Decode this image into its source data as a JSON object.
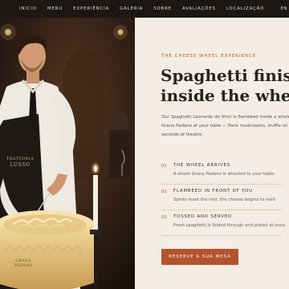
{
  "nav": {
    "items": [
      {
        "label": "INÍCIO"
      },
      {
        "label": "MENU"
      },
      {
        "label": "EXPERIÊNCIA"
      },
      {
        "label": "GALERIA"
      },
      {
        "label": "SOBRE"
      },
      {
        "label": "AVALIAÇÕES"
      },
      {
        "label": "LOCALIZAÇÃO"
      }
    ],
    "lang": "EN"
  },
  "photo": {
    "apron_line1": "TRATTORIA",
    "apron_line2": "LUSSO",
    "wheel_line1": "GRANA",
    "wheel_line2": "PADANO"
  },
  "hero": {
    "eyebrow": "THE CHEESE WHEEL EXPERIENCE",
    "headline_line1": "Spaghetti finished",
    "headline_line2": "inside the wheel.",
    "description_line1": "Our Spaghetti Leonardo de Vinci is flambéed inside a whole",
    "description_line2": "Grana Padano at your table — Paris mushrooms, truffle oil",
    "description_line3": "seconds of theatre."
  },
  "steps": [
    {
      "num": "01",
      "title": "THE WHEEL ARRIVES",
      "text": "A whole Grana Padano is wheeled to your table."
    },
    {
      "num": "02",
      "title": "FLAMBEED IN FRONT OF YOU",
      "text": "Spirits meet the rind, the cheese begins to melt."
    },
    {
      "num": "03",
      "title": "TOSSED AND SERVED",
      "text": "Fresh spaghetti is folded through and plated at once."
    }
  ],
  "cta": {
    "label": "RESERVE A SUA MESA"
  },
  "colors": {
    "accent": "#b4532e",
    "nav_bg": "#1d1714",
    "page_bg": "#f3ede3"
  }
}
